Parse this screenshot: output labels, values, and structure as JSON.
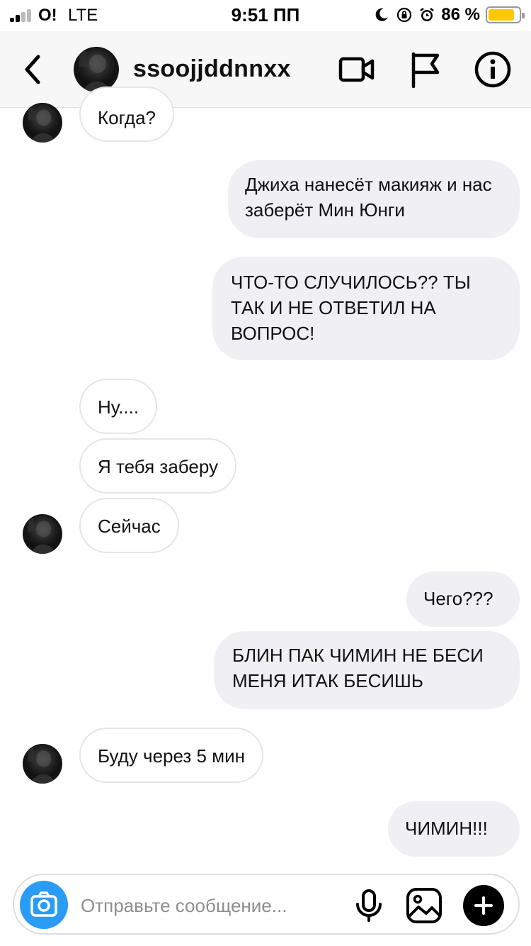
{
  "status_bar": {
    "carrier": "O!",
    "network": "LTE",
    "time": "9:51 ПП",
    "battery_percent": "86 %",
    "battery_level": 0.86,
    "battery_color": "#ffc800",
    "icons": [
      "moon-icon",
      "orientation-lock-icon",
      "alarm-icon"
    ]
  },
  "header": {
    "username": "ssoojjddnnxx",
    "icons": [
      "back-chevron-icon",
      "video-camera-icon",
      "flag-icon",
      "info-icon"
    ]
  },
  "messages": [
    {
      "direction": "in",
      "text": "Когда?",
      "avatar": true
    },
    {
      "direction": "out",
      "text": "Джиха нанесёт макияж и нас заберёт Мин Юнги"
    },
    {
      "direction": "out",
      "text": "ЧТО-ТО СЛУЧИЛОСЬ?? ТЫ ТАК И НЕ ОТВЕТИЛ НА ВОПРОС!"
    },
    {
      "direction": "in",
      "text": "Ну...."
    },
    {
      "direction": "in",
      "text": "Я тебя заберу"
    },
    {
      "direction": "in",
      "text": "Сейчас",
      "avatar": true
    },
    {
      "direction": "out",
      "text": "Чего???"
    },
    {
      "direction": "out",
      "text": "БЛИН ПАК ЧИМИН НЕ БЕСИ МЕНЯ ИТАК БЕСИШЬ"
    },
    {
      "direction": "in",
      "text": "Буду через 5 мин",
      "avatar": true
    },
    {
      "direction": "out",
      "text": "ЧИМИН!!!"
    }
  ],
  "composer": {
    "placeholder": "Отправьте сообщение...",
    "value": "",
    "icons": [
      "camera-icon",
      "microphone-icon",
      "gallery-icon",
      "plus-icon"
    ]
  },
  "colors": {
    "accent": "#2b9cf6",
    "outgoing_bubble": "#efeff4",
    "incoming_border": "#e5e5e5"
  }
}
